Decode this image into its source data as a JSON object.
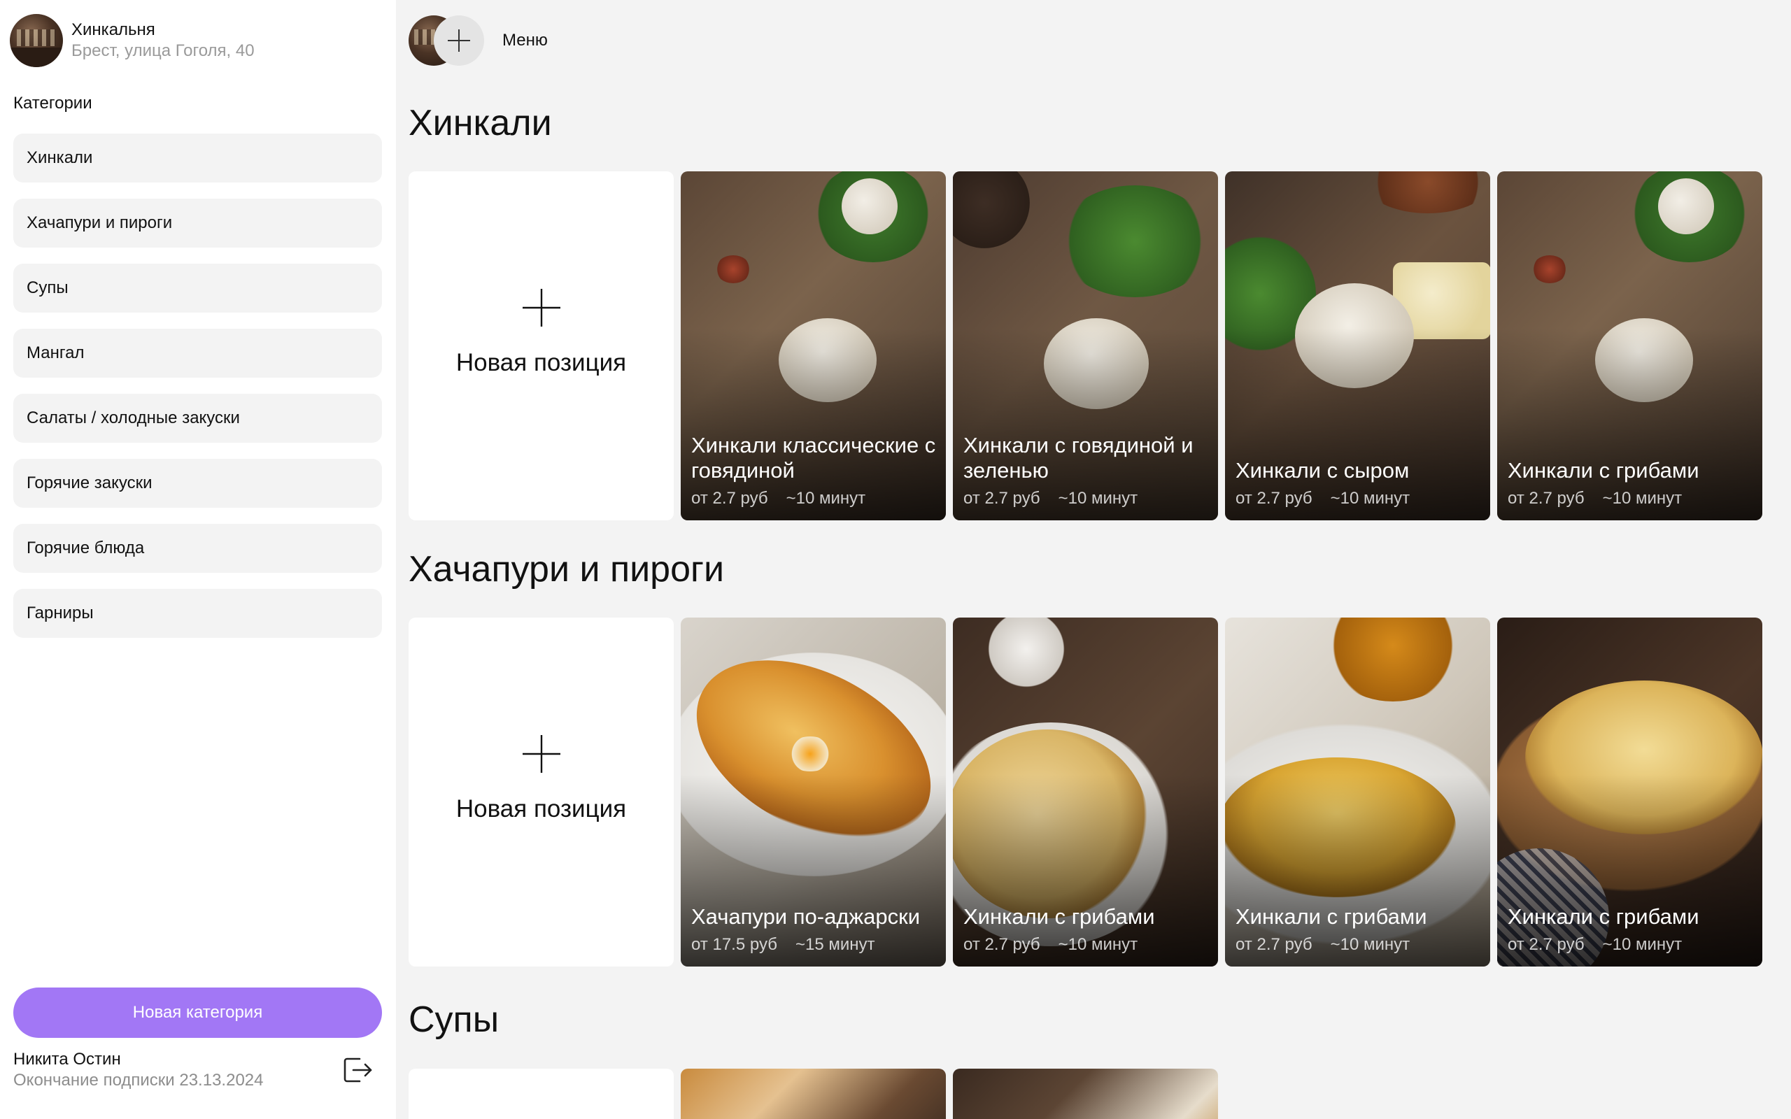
{
  "venue": {
    "name": "Хинкальня",
    "address": "Брест, улица Гоголя, 40"
  },
  "sidebar": {
    "categories_heading": "Категории",
    "categories": [
      {
        "label": "Хинкали"
      },
      {
        "label": "Хачапури и пироги"
      },
      {
        "label": "Супы"
      },
      {
        "label": "Мангал"
      },
      {
        "label": "Салаты / холодные закуски"
      },
      {
        "label": "Горячие закуски"
      },
      {
        "label": "Горячие блюда"
      },
      {
        "label": "Гарниры"
      }
    ],
    "new_category_label": "Новая категория",
    "user": {
      "name": "Никита Остин",
      "subscription": "Окончание подписки 23.13.2024"
    }
  },
  "topbar": {
    "menu_label": "Меню"
  },
  "new_item_label": "Новая позиция",
  "sections": [
    {
      "title": "Хинкали",
      "items": [
        {
          "name": "Хинкали классические с говядиной",
          "price": "от 2.7 руб",
          "time": "~10 минут"
        },
        {
          "name": "Хинкали с говядиной и зеленью",
          "price": "от 2.7 руб",
          "time": "~10 минут"
        },
        {
          "name": "Хинкали с сыром",
          "price": "от 2.7 руб",
          "time": "~10 минут"
        },
        {
          "name": "Хинкали с грибами",
          "price": "от 2.7 руб",
          "time": "~10 минут"
        }
      ]
    },
    {
      "title": "Хачапури и пироги",
      "items": [
        {
          "name": "Хачапури по-аджарски",
          "price": "от 17.5 руб",
          "time": "~15 минут"
        },
        {
          "name": "Хинкали с грибами",
          "price": "от 2.7 руб",
          "time": "~10 минут"
        },
        {
          "name": "Хинкали с грибами",
          "price": "от 2.7 руб",
          "time": "~10 минут"
        },
        {
          "name": "Хинкали с грибами",
          "price": "от 2.7 руб",
          "time": "~10 минут"
        }
      ]
    },
    {
      "title": "Супы",
      "items": []
    }
  ],
  "colors": {
    "accent": "#a277f5",
    "sidebar_bg": "#ffffff",
    "page_bg": "#f3f3f3",
    "category_bg": "#f3f3f3"
  },
  "icons": {
    "add": "plus-icon",
    "logout": "logout-icon"
  }
}
